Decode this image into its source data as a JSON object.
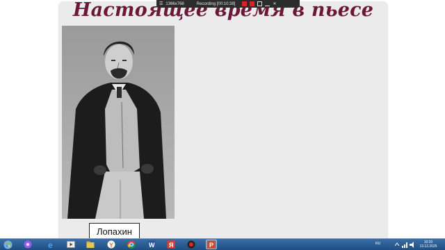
{
  "slide": {
    "title": "Настоящее время в пьесе",
    "caption": "Лопахин"
  },
  "recorder": {
    "resolution": "1366x768",
    "status": "Recording [00:10:38]"
  },
  "taskbar": {
    "apps": [
      "start",
      "browser-alice",
      "internet-explorer",
      "media-player",
      "file-explorer",
      "yandex-browser",
      "chrome",
      "word",
      "yandex",
      "recorder",
      "powerpoint"
    ],
    "language": "RU",
    "time": "10:20",
    "date": "13.12.2025"
  },
  "colors": {
    "title": "#6b1838",
    "taskbar": "#2a5d94",
    "slide_bg": "#ebebeb"
  }
}
